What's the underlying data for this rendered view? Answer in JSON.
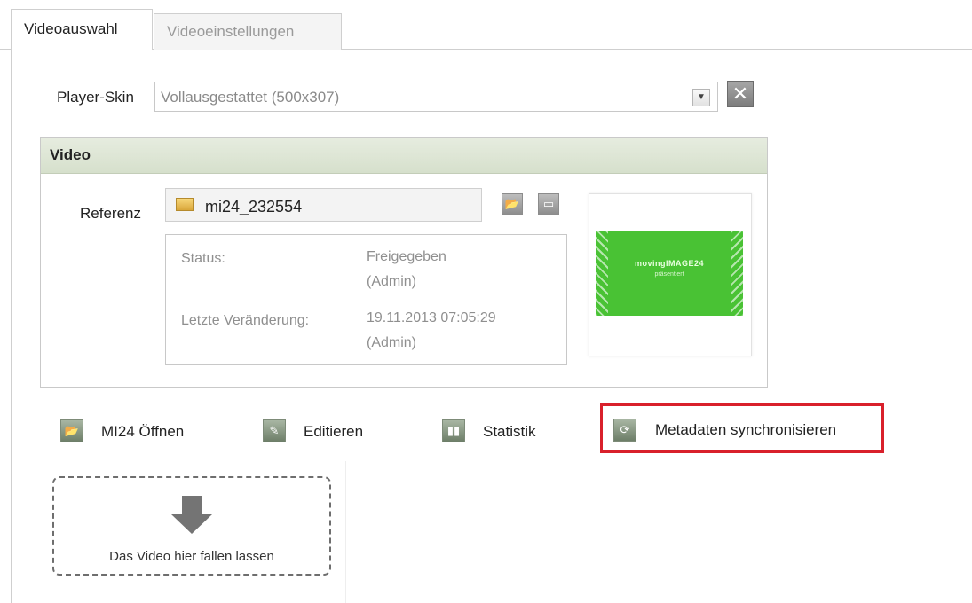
{
  "tabs": [
    {
      "label": "Videoauswahl",
      "active": true
    },
    {
      "label": "Videoeinstellungen",
      "active": false
    }
  ],
  "player_skin": {
    "label": "Player-Skin",
    "value": "Vollausgestattet (500x307)"
  },
  "video_panel": {
    "title": "Video",
    "reference_label": "Referenz",
    "reference_value": "mi24_232554",
    "status_label": "Status:",
    "status_value_line1": "Freigegeben",
    "status_value_line2": "(Admin)",
    "last_change_label": "Letzte Veränderung:",
    "last_change_value_line1": "19.11.2013 07:05:29",
    "last_change_value_line2": "(Admin)",
    "thumbnail_text1": "movingIMAGE24",
    "thumbnail_text2": "präsentiert"
  },
  "actions": {
    "open": "MI24 Öffnen",
    "edit": "Editieren",
    "stats": "Statistik",
    "sync": "Metadaten synchronisieren"
  },
  "dropzone": {
    "text": "Das Video hier fallen lassen"
  },
  "colors": {
    "highlight": "#d9202b",
    "panel_header": "#dbe4d2",
    "thumbnail_green": "#49c234"
  }
}
